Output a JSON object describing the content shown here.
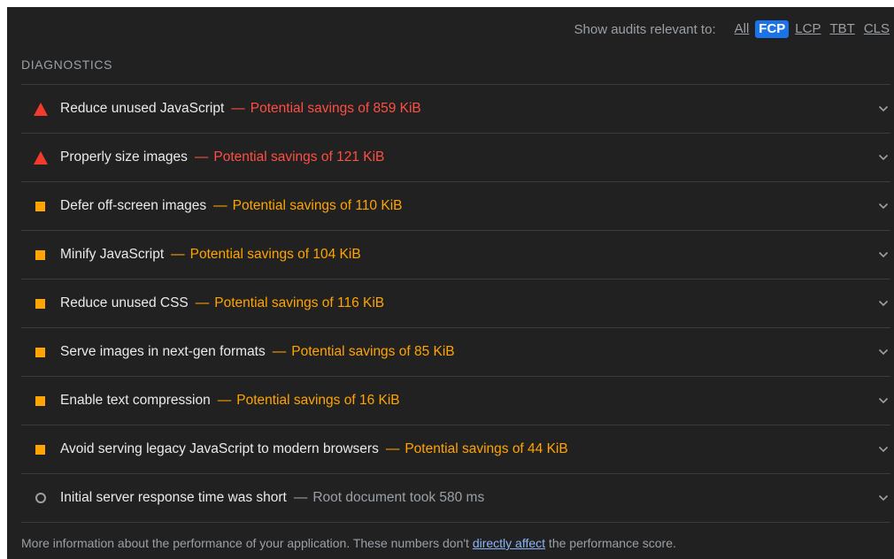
{
  "filter": {
    "label": "Show audits relevant to:",
    "options": [
      "All",
      "FCP",
      "LCP",
      "TBT",
      "CLS"
    ],
    "active": "FCP"
  },
  "section": {
    "title": "DIAGNOSTICS"
  },
  "audits": [
    {
      "title": "Reduce unused JavaScript",
      "separator": "—",
      "detail": "Potential savings of 859 KiB",
      "status": "fail",
      "icon": "fail-triangle-icon",
      "color": "#ff4e42"
    },
    {
      "title": "Properly size images",
      "separator": "—",
      "detail": "Potential savings of 121 KiB",
      "status": "fail",
      "icon": "fail-triangle-icon",
      "color": "#ff4e42"
    },
    {
      "title": "Defer off-screen images",
      "separator": "—",
      "detail": "Potential savings of 110 KiB",
      "status": "average",
      "icon": "average-square-icon",
      "color": "#ffa400"
    },
    {
      "title": "Minify JavaScript",
      "separator": "—",
      "detail": "Potential savings of 104 KiB",
      "status": "average",
      "icon": "average-square-icon",
      "color": "#ffa400"
    },
    {
      "title": "Reduce unused CSS",
      "separator": "—",
      "detail": "Potential savings of 116 KiB",
      "status": "average",
      "icon": "average-square-icon",
      "color": "#ffa400"
    },
    {
      "title": "Serve images in next-gen formats",
      "separator": "—",
      "detail": "Potential savings of 85 KiB",
      "status": "average",
      "icon": "average-square-icon",
      "color": "#ffa400"
    },
    {
      "title": "Enable text compression",
      "separator": "—",
      "detail": "Potential savings of 16 KiB",
      "status": "average",
      "icon": "average-square-icon",
      "color": "#ffa400"
    },
    {
      "title": "Avoid serving legacy JavaScript to modern browsers",
      "separator": "—",
      "detail": "Potential savings of 44 KiB",
      "status": "average",
      "icon": "average-square-icon",
      "color": "#ffa400"
    },
    {
      "title": "Initial server response time was short",
      "separator": "—",
      "detail": "Root document took 580 ms",
      "status": "info",
      "icon": "info-circle-icon",
      "color": "#9aa0a6"
    }
  ],
  "footer": {
    "before": "More information about the performance of your application. These numbers don't ",
    "link": "directly affect",
    "after": " the performance score."
  },
  "colors": {
    "background": "#212121",
    "fail": "#ff4e42",
    "average": "#ffa400",
    "info": "#9aa0a6",
    "active_chip": "#1a73e8",
    "link": "#8ab4f8"
  }
}
